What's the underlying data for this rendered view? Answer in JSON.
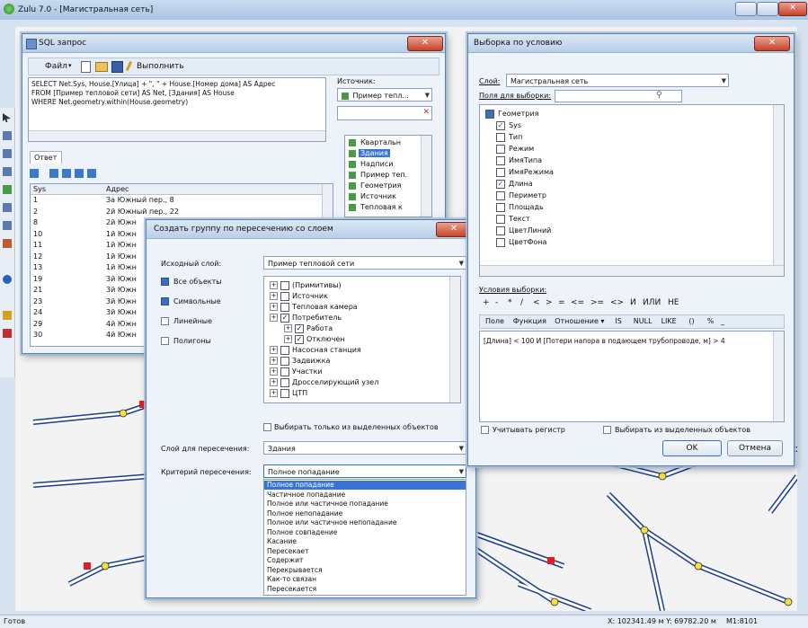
{
  "main_window": {
    "title": "Zulu 7.0 - [Магистральная сеть]",
    "status_ready": "Готов",
    "status_coords": "X: 102341.49 м  Y: 69782.20 м",
    "status_scale": "M1:8101"
  },
  "sql_window": {
    "title": "SQL запрос",
    "file_menu": "Файл",
    "execute_label": "Выполнить",
    "query_lines": [
      "SELECT Net.Sys, House.[Улица] + \", \" + House.[Номер дома] AS Адрес",
      "FROM [Пример тепловой сети] AS Net, [Здания] AS House",
      "WHERE Net.geometry.within(House.geometry)"
    ],
    "source_label": "Источник:",
    "source_value": "Пример тепл...",
    "tree": [
      {
        "label": "Квартальн",
        "selected": false
      },
      {
        "label": "Здания",
        "selected": true
      },
      {
        "label": "Надписи",
        "selected": false
      },
      {
        "label": "Пример теп.",
        "selected": false
      },
      {
        "label": "Геометрия",
        "selected": false
      },
      {
        "label": "Источник",
        "selected": false
      },
      {
        "label": "Тепловая к",
        "selected": false
      }
    ],
    "answer_tab": "Ответ",
    "columns": [
      "Sys",
      "Адрес"
    ],
    "rows": [
      [
        "1",
        "За Южный пер., 8"
      ],
      [
        "2",
        "2й Южный пер., 22"
      ],
      [
        "8",
        "2й Южн"
      ],
      [
        "10",
        "1й Южн"
      ],
      [
        "11",
        "1й Южн"
      ],
      [
        "12",
        "1й Южн"
      ],
      [
        "13",
        "1й Южн"
      ],
      [
        "19",
        "3й Южн"
      ],
      [
        "21",
        "3й Южн"
      ],
      [
        "23",
        "3й Южн"
      ],
      [
        "24",
        "3й Южн"
      ],
      [
        "29",
        "4й Южн"
      ],
      [
        "30",
        "4й Южн"
      ]
    ]
  },
  "group_dialog": {
    "title": "Создать группу по пересечению со слоем",
    "source_layer_label": "Исходный слой:",
    "source_layer_value": "Пример тепловой сети",
    "object_types": [
      {
        "label": "Все объекты",
        "checked": true
      },
      {
        "label": "Символьные",
        "checked": true
      },
      {
        "label": "Линейные",
        "checked": false
      },
      {
        "label": "Полигоны",
        "checked": false
      }
    ],
    "tree": [
      {
        "label": "(Примитивы)",
        "checked": false,
        "indent": 0
      },
      {
        "label": "Источник",
        "checked": false,
        "indent": 0
      },
      {
        "label": "Тепловая камера",
        "checked": false,
        "indent": 0
      },
      {
        "label": "Потребитель",
        "checked": true,
        "indent": 0
      },
      {
        "label": "Работа",
        "checked": true,
        "indent": 1
      },
      {
        "label": "Отключен",
        "checked": true,
        "indent": 1
      },
      {
        "label": "Насосная станция",
        "checked": false,
        "indent": 0
      },
      {
        "label": "Задвижка",
        "checked": false,
        "indent": 0
      },
      {
        "label": "Участки",
        "checked": false,
        "indent": 0
      },
      {
        "label": "Дросселирующий узел",
        "checked": false,
        "indent": 0
      },
      {
        "label": "ЦТП",
        "checked": false,
        "indent": 0
      }
    ],
    "only_selected_label": "Выбирать только из выделенных объектов",
    "intersect_layer_label": "Слой для пересечения:",
    "intersect_layer_value": "Здания",
    "criterion_label": "Критерий пересечения:",
    "criterion_value": "Полное попадание",
    "criterion_options": [
      "Полное попадание",
      "Частичное попадание",
      "Полное или частичное попадание",
      "Полное непопадание",
      "Полное или частичное непопадание",
      "Полное совпадение",
      "Касание",
      "Пересекает",
      "Содержит",
      "Перекрывается",
      "Как-то связан",
      "Пересекается"
    ]
  },
  "selection_window": {
    "title": "Выборка по условию",
    "layer_label": "Слой:",
    "layer_value": "Магистральная сеть",
    "fields_label": "Поля для выборки:",
    "fields": [
      {
        "label": "Геометрия",
        "checked": true,
        "indent": 0
      },
      {
        "label": "Sys",
        "checked": true,
        "indent": 1
      },
      {
        "label": "Тип",
        "checked": false,
        "indent": 1
      },
      {
        "label": "Режим",
        "checked": false,
        "indent": 1
      },
      {
        "label": "ИмяТипа",
        "checked": false,
        "indent": 1
      },
      {
        "label": "ИмяРежима",
        "checked": false,
        "indent": 1
      },
      {
        "label": "Длина",
        "checked": true,
        "indent": 1
      },
      {
        "label": "Периметр",
        "checked": false,
        "indent": 1
      },
      {
        "label": "Площадь",
        "checked": false,
        "indent": 1
      },
      {
        "label": "Текст",
        "checked": false,
        "indent": 1
      },
      {
        "label": "ЦветЛиний",
        "checked": false,
        "indent": 1
      },
      {
        "label": "ЦветФона",
        "checked": false,
        "indent": 1
      }
    ],
    "conditions_label": "Условия выборки:",
    "operators": [
      "+",
      "-",
      "*",
      "/",
      "<",
      ">",
      "=",
      "<=",
      ">=",
      "<>",
      "И",
      "ИЛИ",
      "НЕ"
    ],
    "toolbar2": [
      "Поле",
      "Функция",
      "Отношение ▾",
      "IS",
      "NULL",
      "LIKE",
      "()",
      "%",
      "_"
    ],
    "condition_text": "[Длина] < 100 И [Потери напора в подающем трубопроводе, м] > 4",
    "case_sensitive_label": "Учитывать регистр",
    "only_selected_label": "Выбирать из выделенных объектов",
    "ok_label": "OK",
    "cancel_label": "Отмена"
  },
  "colors": {
    "accent": "#3874d6",
    "map_line": "#1a3d8f",
    "map_node": "#f3e040",
    "map_red": "#e02020"
  }
}
